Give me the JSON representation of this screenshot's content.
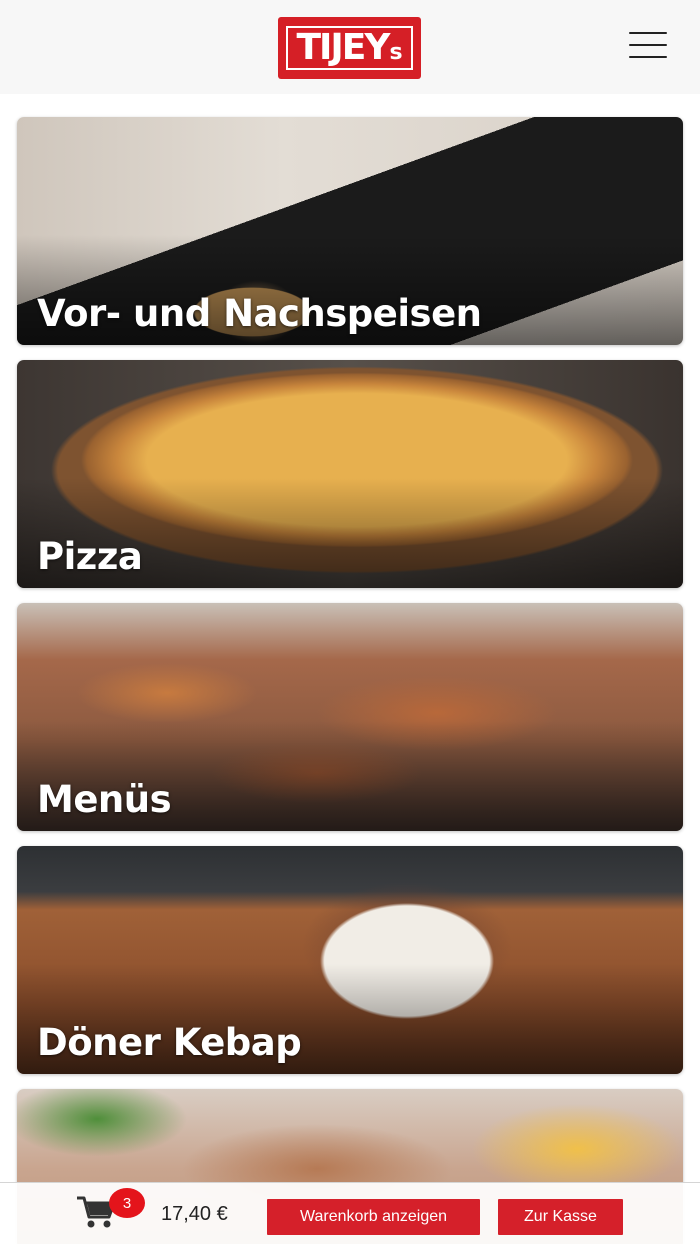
{
  "header": {
    "logo_text": "TIJEY",
    "logo_suffix": "s",
    "menu_icon": "hamburger-menu-icon"
  },
  "categories": [
    {
      "label": "Vor- und Nachspeisen"
    },
    {
      "label": "Pizza"
    },
    {
      "label": "Menüs"
    },
    {
      "label": "Döner Kebap"
    },
    {
      "label": ""
    }
  ],
  "cart": {
    "icon": "shopping-cart-icon",
    "count": "3",
    "total": "17,40 €",
    "show_cart_label": "Warenkorb anzeigen",
    "checkout_label": "Zur Kasse"
  },
  "colors": {
    "brand_red": "#d51f26",
    "header_bg": "#f7f7f7"
  }
}
